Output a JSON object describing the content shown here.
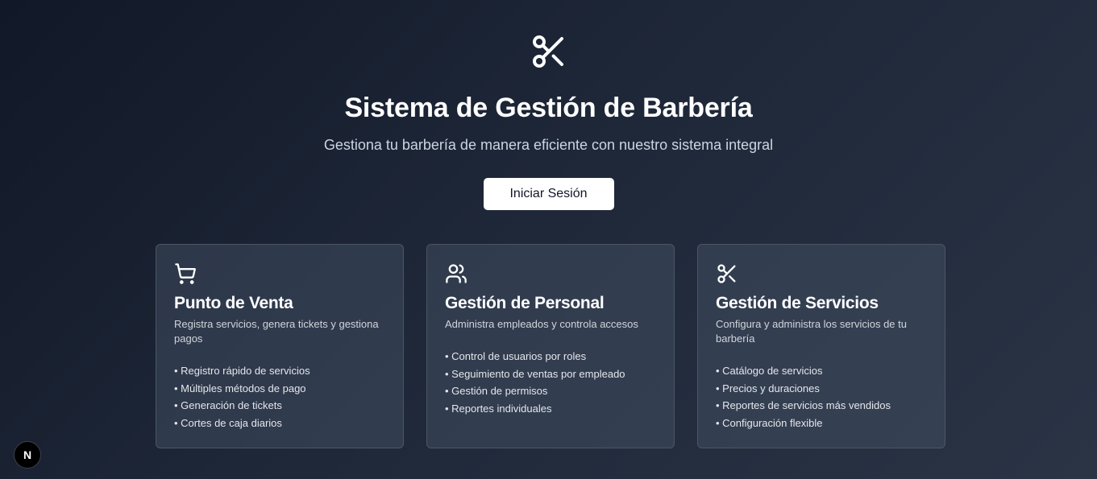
{
  "hero": {
    "icon": "scissors-icon",
    "title": "Sistema de Gestión de Barbería",
    "subtitle": "Gestiona tu barbería de manera eficiente con nuestro sistema integral",
    "login_label": "Iniciar Sesión"
  },
  "cards": [
    {
      "icon": "shopping-cart-icon",
      "title": "Punto de Venta",
      "description": "Registra servicios, genera tickets y gestiona pagos",
      "features": [
        "• Registro rápido de servicios",
        "• Múltiples métodos de pago",
        "• Generación de tickets",
        "• Cortes de caja diarios"
      ]
    },
    {
      "icon": "users-icon",
      "title": "Gestión de Personal",
      "description": "Administra empleados y controla accesos",
      "features": [
        "• Control de usuarios por roles",
        "• Seguimiento de ventas por empleado",
        "• Gestión de permisos",
        "• Reportes individuales"
      ]
    },
    {
      "icon": "scissors-icon",
      "title": "Gestión de Servicios",
      "description": "Configura y administra los servicios de tu barbería",
      "features": [
        "• Catálogo de servicios",
        "• Precios y duraciones",
        "• Reportes de servicios más vendidos",
        "• Configuración flexible"
      ]
    }
  ],
  "dev_badge": {
    "icon": "nextjs-logo-icon",
    "letter": "N"
  }
}
